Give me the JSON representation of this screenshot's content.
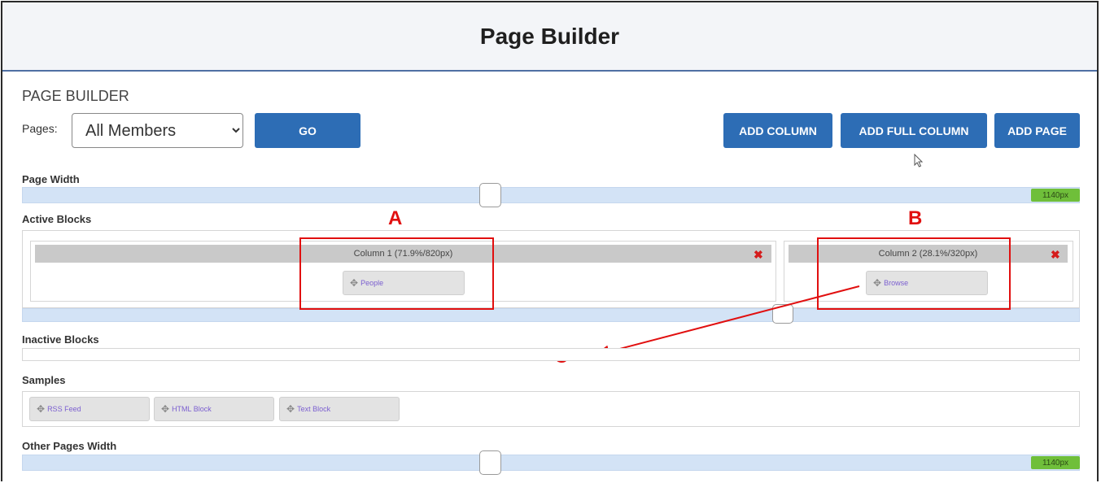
{
  "title": "Page Builder",
  "section_title": "PAGE BUILDER",
  "pages": {
    "label": "Pages:",
    "selected": "All Members",
    "go_label": "GO"
  },
  "buttons": {
    "add_column": "ADD COLUMN",
    "add_full_column": "ADD FULL COLUMN",
    "add_page": "ADD PAGE"
  },
  "page_width": {
    "label": "Page Width",
    "value_badge": "1140px",
    "slider_fraction": 0.45
  },
  "active_blocks": {
    "label": "Active Blocks",
    "columns": [
      {
        "title": "Column 1 (71.9%/820px)",
        "block": "People"
      },
      {
        "title": "Column 2 (28.1%/320px)",
        "block": "Browse"
      }
    ],
    "split_fraction": 0.719
  },
  "inactive_blocks": {
    "label": "Inactive Blocks"
  },
  "samples": {
    "label": "Samples",
    "items": [
      "RSS Feed",
      "HTML Block",
      "Text Block"
    ]
  },
  "other_pages_width": {
    "label": "Other Pages Width",
    "value_badge": "1140px",
    "slider_fraction": 0.45
  },
  "annotations": {
    "a": "A",
    "b": "B",
    "c": "C"
  },
  "colors": {
    "accent": "#2d6db5",
    "annotation": "#e10f0f",
    "badge": "#6fbf3a",
    "track": "#d3e3f6"
  },
  "icons": {
    "close": "close-icon",
    "move": "move-icon",
    "cursor": "mouse-cursor-icon"
  }
}
